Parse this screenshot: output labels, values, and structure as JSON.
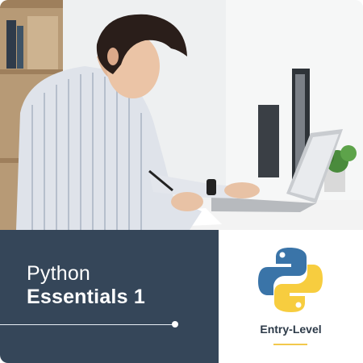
{
  "course": {
    "title_line1": "Python",
    "title_line2": "Essentials 1",
    "level": "Entry-Level"
  },
  "colors": {
    "panel_dark": "#354659",
    "python_blue": "#3a74a8",
    "python_yellow": "#f7cd3f",
    "accent_underline": "#f2c94c"
  },
  "icons": {
    "logo": "python-logo-icon"
  }
}
